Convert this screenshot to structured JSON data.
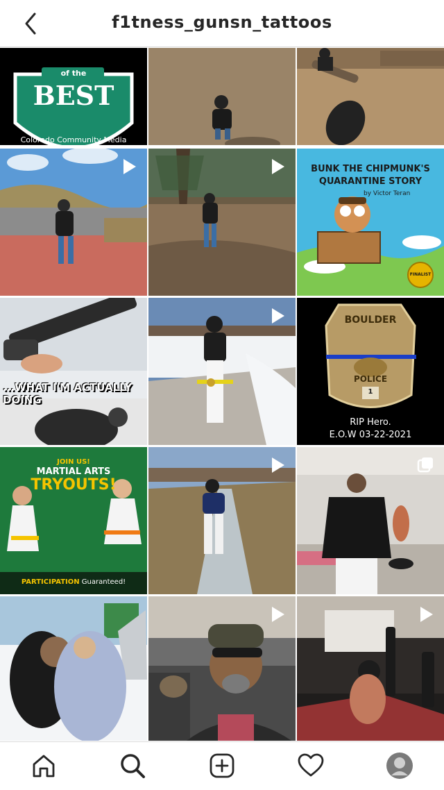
{
  "header": {
    "username": "f1tness_gunsn_tattoos",
    "back_icon": "chevron-left-icon"
  },
  "posts": [
    {
      "id": 1,
      "type": "image",
      "texts": {
        "top": "of the",
        "big": "BEST",
        "sub": "Colorado Community Media"
      }
    },
    {
      "id": 2,
      "type": "image"
    },
    {
      "id": 3,
      "type": "image"
    },
    {
      "id": 4,
      "type": "video"
    },
    {
      "id": 5,
      "type": "video"
    },
    {
      "id": 6,
      "type": "image",
      "texts": {
        "title1": "BUNK THE CHIPMUNK'S",
        "title2": "QUARANTINE STORY",
        "author": "by Victor Teran",
        "seal": "FINALIST"
      }
    },
    {
      "id": 7,
      "type": "image",
      "texts": {
        "caption": "...WHAT I'M ACTUALLY DOING"
      }
    },
    {
      "id": 8,
      "type": "video"
    },
    {
      "id": 9,
      "type": "image",
      "texts": {
        "badge_top": "BOULDER",
        "badge_bottom": "POLICE",
        "badge_num": "1",
        "rip": "RIP Hero.",
        "eow": "E.O.W 03-22-2021"
      }
    },
    {
      "id": 10,
      "type": "image",
      "texts": {
        "join": "JOIN US!",
        "line1": "MARTIAL ARTS",
        "line2": "TRYOUTS!",
        "participation": "PARTICIPATION",
        "guaranteed": "Guaranteed!"
      }
    },
    {
      "id": 11,
      "type": "video"
    },
    {
      "id": 12,
      "type": "carousel"
    },
    {
      "id": 13,
      "type": "image"
    },
    {
      "id": 14,
      "type": "video"
    },
    {
      "id": 15,
      "type": "video"
    }
  ],
  "bottom_nav": [
    {
      "name": "home-icon"
    },
    {
      "name": "search-icon"
    },
    {
      "name": "new-post-icon"
    },
    {
      "name": "activity-heart-icon"
    },
    {
      "name": "profile-avatar"
    }
  ],
  "colors": {
    "border": "#dbdbdb",
    "text": "#262626",
    "yellow": "#f5c400"
  }
}
